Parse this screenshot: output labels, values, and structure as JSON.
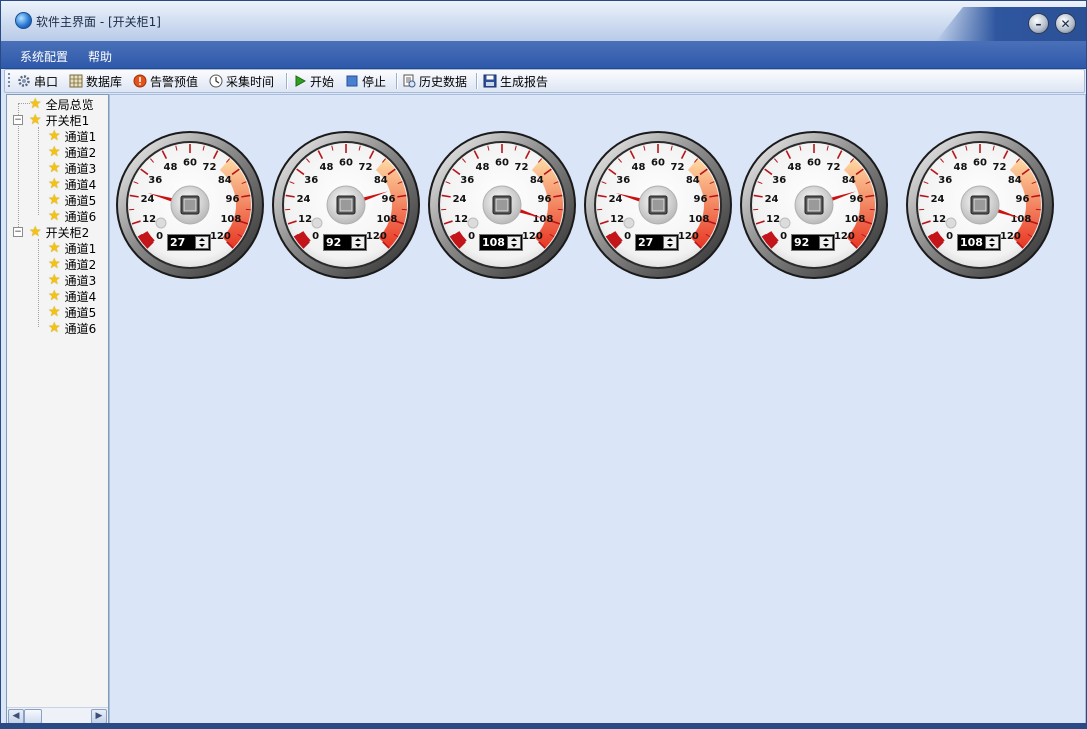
{
  "window": {
    "title": "软件主界面 - [开关柜1]"
  },
  "menu": {
    "items": [
      "系统配置",
      "帮助"
    ]
  },
  "toolbar": {
    "items": [
      {
        "label": "串口",
        "icon": "gear-icon"
      },
      {
        "label": "数据库",
        "icon": "database-icon"
      },
      {
        "label": "告警预值",
        "icon": "alarm-icon"
      },
      {
        "label": "采集时间",
        "icon": "clock-icon"
      },
      {
        "label": "开始",
        "icon": "play-icon"
      },
      {
        "label": "停止",
        "icon": "stop-icon"
      },
      {
        "label": "历史数据",
        "icon": "history-icon"
      },
      {
        "label": "生成报告",
        "icon": "save-icon"
      }
    ]
  },
  "tree": {
    "root": "全局总览",
    "cabinets": [
      {
        "label": "开关柜1",
        "channels": [
          "通道1",
          "通道2",
          "通道3",
          "通道4",
          "通道5",
          "通道6"
        ]
      },
      {
        "label": "开关柜2",
        "channels": [
          "通道1",
          "通道2",
          "通道3",
          "通道4",
          "通道5",
          "通道6"
        ]
      }
    ]
  },
  "gauges": {
    "scale": {
      "min": 0,
      "max": 120,
      "labels": [
        "0",
        "12",
        "24",
        "36",
        "48",
        "60",
        "72",
        "84",
        "96",
        "108",
        "120"
      ]
    },
    "needle_color": "#cc1111",
    "items": [
      {
        "value": 27,
        "display": "27"
      },
      {
        "value": 92,
        "display": "92"
      },
      {
        "value": 108,
        "display": "108"
      },
      {
        "value": 27,
        "display": "27"
      },
      {
        "value": 92,
        "display": "92"
      },
      {
        "value": 108,
        "display": "108"
      }
    ]
  }
}
